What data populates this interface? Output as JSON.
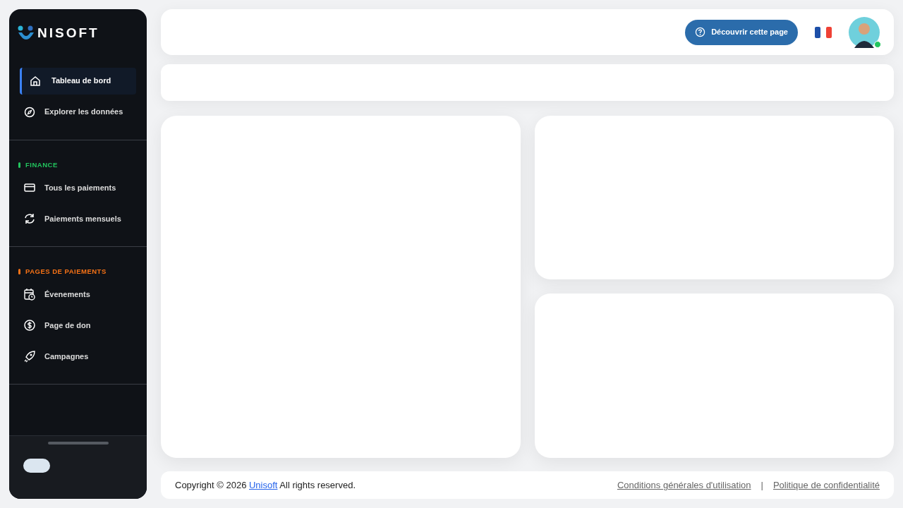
{
  "logo": {
    "text": "NISOFT"
  },
  "sidebar": {
    "items": [
      {
        "kind": "home",
        "label": "Tableau de bord",
        "selected": true
      },
      {
        "kind": "compass",
        "label": "Explorer les données",
        "selected": false
      }
    ],
    "sections": [
      {
        "title": "FINANCE",
        "color": "#22c55e",
        "items": [
          {
            "kind": "card",
            "label": "Tous les paiements",
            "selected": false
          },
          {
            "kind": "refresh",
            "label": "Paiements mensuels",
            "selected": false
          }
        ]
      },
      {
        "title": "PAGES DE PAIEMENTS",
        "color": "#f97316",
        "items": [
          {
            "kind": "calendar",
            "label": "Évenements",
            "selected": false
          },
          {
            "kind": "dollar",
            "label": "Page de don",
            "selected": false
          },
          {
            "kind": "rocket",
            "label": "Campagnes",
            "selected": false
          }
        ]
      }
    ]
  },
  "header": {
    "tour_button": "Découvrir cette page",
    "user": {
      "online": true
    }
  },
  "footer": {
    "copyright_before": "Copyright © 2026",
    "company_link": "Unisoft",
    "copyright_after": "All rights reserved.",
    "links": [
      "Conditions générales d'utilisation",
      "Politique de confidentialité"
    ],
    "separator": "|"
  }
}
